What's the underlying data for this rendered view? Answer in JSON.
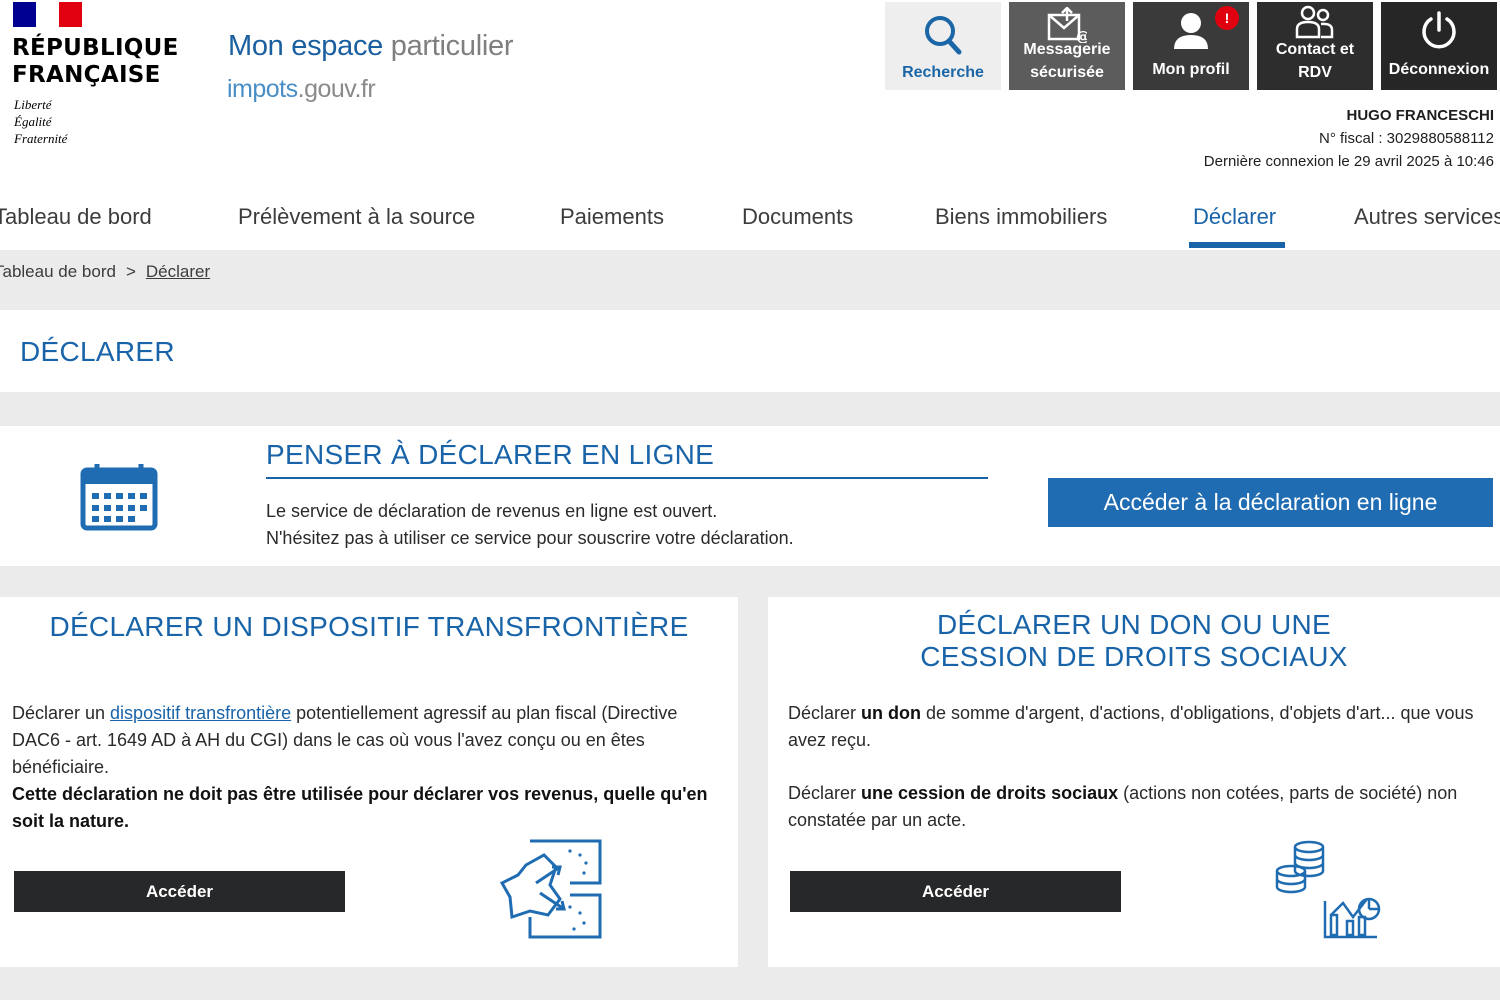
{
  "brand": {
    "republique_line1": "RÉPUBLIQUE",
    "republique_line2": "FRANÇAISE",
    "motto": [
      "Liberté",
      "Égalité",
      "Fraternité"
    ],
    "site_title_strong": "Mon espace",
    "site_title_light": "particulier",
    "site_url_main": "impots",
    "site_url_rest": ".gouv.fr"
  },
  "toolbar": {
    "search_label": "Recherche",
    "messaging_label_1": "Messagerie",
    "messaging_label_2": "sécurisée",
    "profile_label": "Mon profil",
    "profile_badge": "!",
    "contact_label_1": "Contact et",
    "contact_label_2": "RDV",
    "logout_label": "Déconnexion"
  },
  "user": {
    "name": "HUGO FRANCESCHI",
    "fiscal_number": "N° fiscal : 3029880588112",
    "last_login": "Dernière connexion le 29 avril 2025 à 10:46"
  },
  "nav": {
    "items": [
      "Tableau de bord",
      "Prélèvement à la source",
      "Paiements",
      "Documents",
      "Biens immobiliers",
      "Déclarer",
      "Autres services"
    ],
    "active": "Déclarer"
  },
  "breadcrumb": {
    "home": "Tableau de bord",
    "separator": ">",
    "current": "Déclarer"
  },
  "page": {
    "title": "DÉCLARER"
  },
  "promo": {
    "title": "PENSER À DÉCLARER EN LIGNE",
    "line1": "Le service de déclaration de revenus en ligne est ouvert.",
    "line2": "N'hésitez pas à utiliser ce service pour souscrire votre déclaration.",
    "button_label": "Accéder à la déclaration en ligne"
  },
  "card_cross_border": {
    "title": "DÉCLARER UN DISPOSITIF TRANSFRONTIÈRE",
    "text_before_link": "Déclarer un ",
    "link_text": "dispositif transfrontière",
    "text_after_link": " potentiellement agressif au plan fiscal (Directive DAC6 - art. 1649 AD à AH du CGI) dans le cas où vous l'avez conçu ou en êtes bénéficiaire.",
    "warning": "Cette déclaration ne doit pas être utilisée pour déclarer vos revenus, quelle qu'en soit la nature.",
    "button_label": "Accéder"
  },
  "card_gift": {
    "title_line1": "DÉCLARER UN DON OU UNE",
    "title_line2": "CESSION DE DROITS SOCIAUX",
    "p1_before": "Déclarer ",
    "p1_bold": "un don",
    "p1_after": " de somme d'argent, d'actions, d'obligations, d'objets d'art... que vous avez reçu.",
    "p2_before": "Déclarer ",
    "p2_bold": "une cession de droits sociaux",
    "p2_after": " (actions non cotées, parts de société) non constatée par un acte.",
    "button_label": "Accéder"
  },
  "colors": {
    "primary_blue": "#1964a8",
    "button_blue": "#1f6cb2",
    "dark_button": "#27282a",
    "alert_red": "#e1000f"
  },
  "icons": [
    "search-icon",
    "envelope-icon",
    "user-icon",
    "contacts-icon",
    "power-icon",
    "calendar-icon",
    "map-arrows-icon",
    "coins-chart-icon"
  ]
}
